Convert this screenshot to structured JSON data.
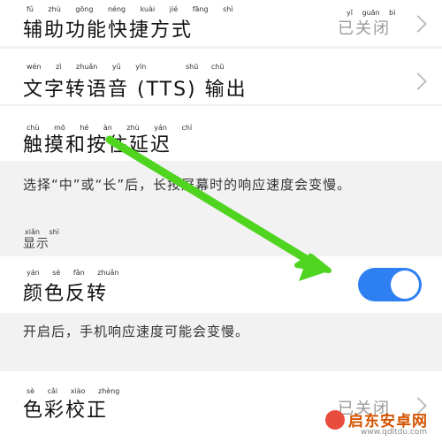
{
  "rows": {
    "assist": {
      "label": "辅助功能快捷方式",
      "value": "已关闭"
    },
    "tts": {
      "label": "文字转语音 (TTS) 输出"
    },
    "touch_delay": {
      "label": "触摸和按住延迟"
    },
    "invert": {
      "label": "颜色反转",
      "enabled": true
    },
    "color_correct": {
      "label": "色彩校正",
      "value": "已关闭"
    }
  },
  "pinyin": {
    "assist": [
      "fǔ",
      "zhù",
      "gōng",
      "néng",
      "kuài",
      "jié",
      "fāng",
      "shì"
    ],
    "assist_value": [
      "yǐ",
      "guān",
      "bì"
    ],
    "tts": [
      "wén",
      "zì",
      "zhuǎn",
      "yǔ",
      "yīn"
    ],
    "tts_out": [
      "shū",
      "chū"
    ],
    "touch": [
      "chù",
      "mō",
      "hé",
      "àn",
      "zhù",
      "yán",
      "chí"
    ],
    "invert": [
      "yán",
      "sè",
      "fǎn",
      "zhuǎn"
    ],
    "color": [
      "sè",
      "cǎi",
      "xiào",
      "zhèng"
    ],
    "header": [
      "xiǎn",
      "shì"
    ]
  },
  "descriptions": {
    "touch_delay": "选择“中”或“长”后，长按屏幕时的响应速度会变慢。",
    "invert": "开启后，手机响应速度可能会变慢。"
  },
  "sections": {
    "display": "显示"
  },
  "watermark": {
    "name": "启东安卓网",
    "site": "www.qdltdu.com"
  },
  "colors": {
    "accent": "#2d7ff2",
    "arrow": "#4fd420"
  }
}
